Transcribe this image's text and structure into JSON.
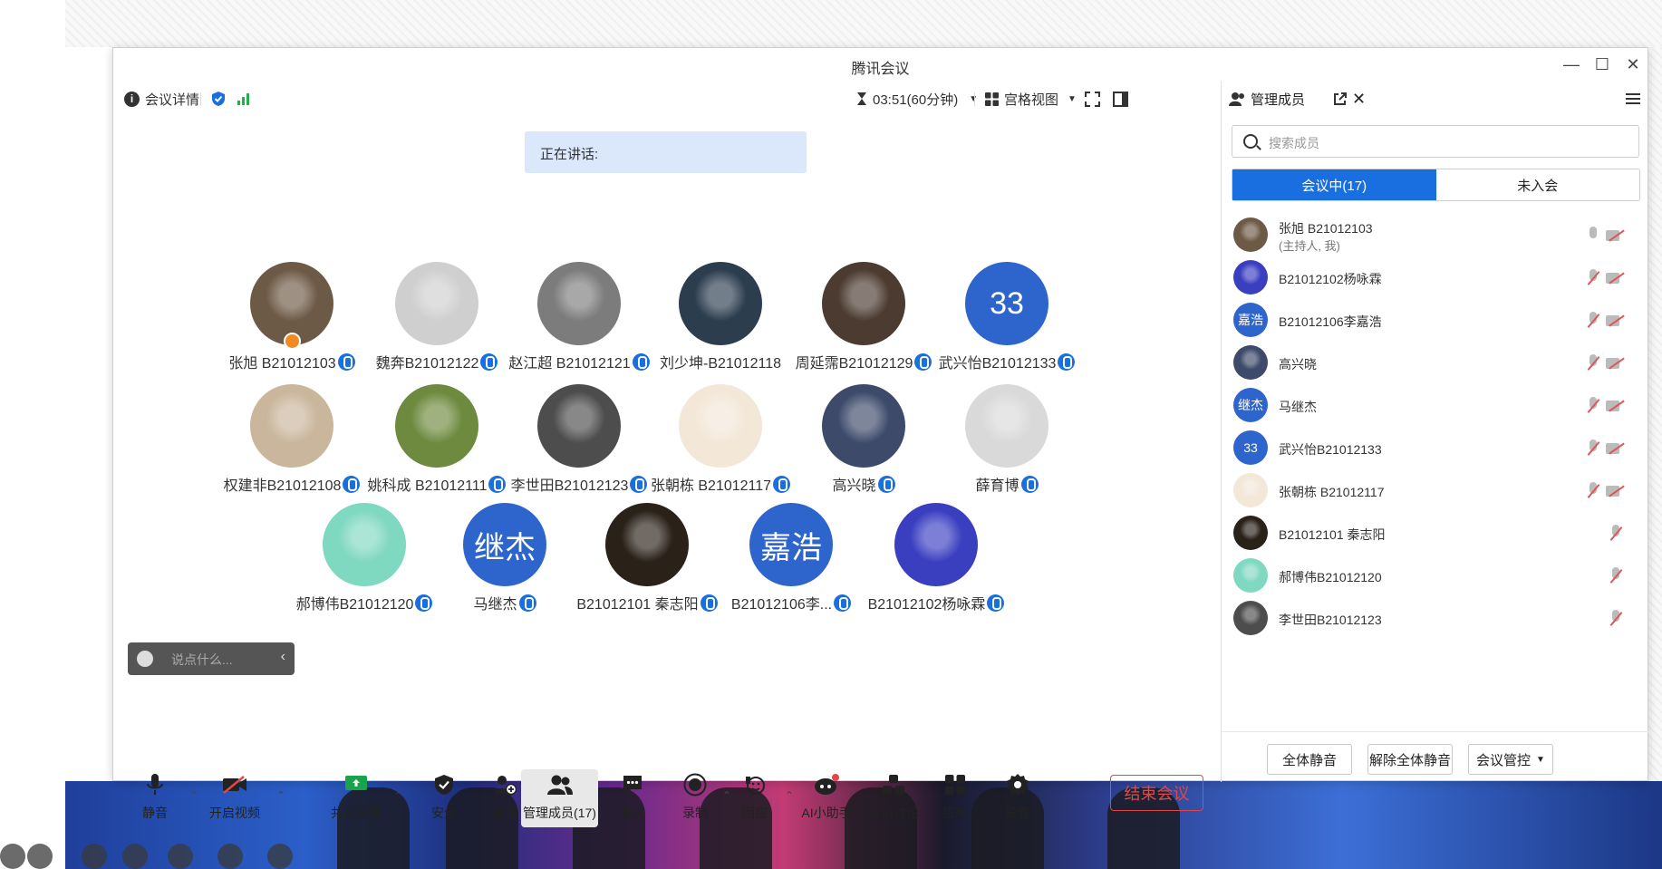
{
  "window": {
    "title": "腾讯会议"
  },
  "topbar": {
    "meeting_info": "会议详情",
    "timer": "03:51(60分钟)",
    "view_mode": "宫格视图"
  },
  "speaking_label": "正在讲话:",
  "tiles": [
    {
      "name": "张旭 B21012103",
      "avatar": "photo",
      "color": "#6d5a46",
      "host": true
    },
    {
      "name": "魏奔B21012122",
      "avatar": "photo",
      "color": "#cfcfcf"
    },
    {
      "name": "赵江超 B21012121",
      "avatar": "photo",
      "color": "#7c7c7c"
    },
    {
      "name": "刘少坤-B21012118",
      "avatar": "photo",
      "color": "#2c3d4e"
    },
    {
      "name": "周延霈B21012129",
      "avatar": "photo",
      "color": "#4b3b30"
    },
    {
      "name": "武兴怡B21012133",
      "avatar": "text",
      "text": "33"
    },
    {
      "name": "权建非B21012108",
      "avatar": "photo",
      "color": "#c9b69c"
    },
    {
      "name": "姚科成 B21012111",
      "avatar": "photo",
      "color": "#6d8a3e"
    },
    {
      "name": "李世田B21012123",
      "avatar": "photo",
      "color": "#4d4d4d"
    },
    {
      "name": "张朝栋 B21012117",
      "avatar": "photo",
      "color": "#f3e7d8"
    },
    {
      "name": "高兴晓",
      "avatar": "photo",
      "color": "#3d4a6a"
    },
    {
      "name": "薛育博",
      "avatar": "photo",
      "color": "#d9d9d9"
    },
    {
      "name": "郝博伟B21012120",
      "avatar": "photo",
      "color": "#7fd8c0"
    },
    {
      "name": "马继杰",
      "avatar": "text",
      "text": "继杰"
    },
    {
      "name": "B21012101 秦志阳",
      "avatar": "photo",
      "color": "#2a2118"
    },
    {
      "name": "B21012106李...",
      "avatar": "text",
      "text": "嘉浩"
    },
    {
      "name": "B21012102杨咏霖",
      "avatar": "photo",
      "color": "#3a3fc0"
    }
  ],
  "chat_placeholder": "说点什么...",
  "toolbar": {
    "mute": "静音",
    "video": "开启视频",
    "share": "共享屏幕",
    "security": "安全",
    "invite": "邀请",
    "members": "管理成员(17)",
    "chat": "聊天",
    "record": "录制",
    "react": "回应",
    "ai": "AI小助手",
    "breakout": "分组讨论",
    "apps": "应用",
    "settings": "设置",
    "end": "结束会议"
  },
  "panel": {
    "title": "管理成员",
    "search_placeholder": "搜索成员",
    "tab_in": "会议中(17)",
    "tab_out": "未入会",
    "rows": [
      {
        "name": "张旭 B21012103",
        "sub": "(主持人, 我)",
        "avatar": "photo",
        "color": "#6d5a46",
        "mic_muted": false,
        "cam": true
      },
      {
        "name": "B21012102杨咏霖",
        "avatar": "photo",
        "color": "#3a3fc0",
        "mic_muted": true,
        "cam": true
      },
      {
        "name": "B21012106李嘉浩",
        "avatar": "text",
        "text": "嘉浩",
        "mic_muted": true,
        "cam": true
      },
      {
        "name": "高兴晓",
        "avatar": "photo",
        "color": "#3d4a6a",
        "mic_muted": true,
        "cam": true
      },
      {
        "name": "马继杰",
        "avatar": "text",
        "text": "继杰",
        "mic_muted": true,
        "cam": true
      },
      {
        "name": "武兴怡B21012133",
        "avatar": "text",
        "text": "33",
        "mic_muted": true,
        "cam": true
      },
      {
        "name": "张朝栋 B21012117",
        "avatar": "photo",
        "color": "#f3e7d8",
        "mic_muted": true,
        "cam": true
      },
      {
        "name": "B21012101 秦志阳",
        "avatar": "photo",
        "color": "#2a2118",
        "mic_muted": true,
        "cam": false
      },
      {
        "name": "郝博伟B21012120",
        "avatar": "photo",
        "color": "#7fd8c0",
        "mic_muted": true,
        "cam": false
      },
      {
        "name": "李世田B21012123",
        "avatar": "photo",
        "color": "#4d4d4d",
        "mic_muted": true,
        "cam": false
      }
    ],
    "mute_all": "全体静音",
    "unmute_all": "解除全体静音",
    "control": "会议管控"
  },
  "colors": {
    "accent": "#1a6fe0",
    "end_red": "#e04848",
    "avatar_blue": "#2d65cc"
  }
}
